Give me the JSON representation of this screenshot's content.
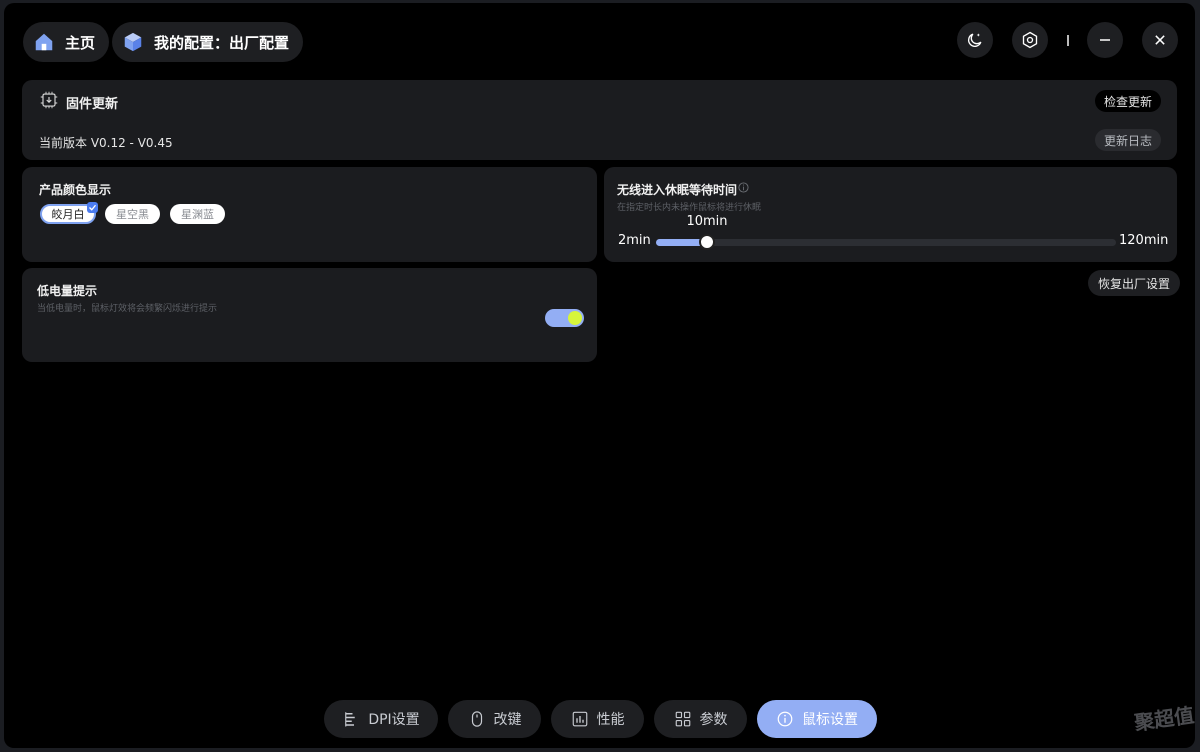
{
  "header": {
    "home_label": "主页",
    "config_label": "我的配置：出厂配置"
  },
  "firmware": {
    "title": "固件更新",
    "version": "当前版本 V0.12 - V0.45",
    "check_update": "检查更新",
    "changelog": "更新日志"
  },
  "color_display": {
    "title": "产品颜色显示",
    "options": [
      "皎月白",
      "星空黑",
      "星渊蓝"
    ],
    "selected": "皎月白"
  },
  "sleep": {
    "title": "无线进入休眠等待时间",
    "subtitle": "在指定时长内未操作鼠标将进行休眠",
    "min_label": "2min",
    "max_label": "120min",
    "value_label": "10min",
    "min": 2,
    "max": 120,
    "value": 10
  },
  "restore_button": "恢复出厂设置",
  "low_battery": {
    "title": "低电量提示",
    "subtitle": "当低电量时，鼠标灯效将会频繁闪烁进行提示",
    "enabled": true
  },
  "bottom_nav": [
    {
      "label": "DPI设置",
      "icon": "dpi-icon",
      "active": false
    },
    {
      "label": "改键",
      "icon": "mouse-icon",
      "active": false
    },
    {
      "label": "性能",
      "icon": "performance-icon",
      "active": false
    },
    {
      "label": "参数",
      "icon": "grid-icon",
      "active": false
    },
    {
      "label": "鼠标设置",
      "icon": "info-icon",
      "active": true
    }
  ],
  "watermark": "聚超值",
  "colors": {
    "accent": "#93aef4",
    "toggle_knob": "#d6f53b",
    "card_bg": "#1b1c1f",
    "window_bg": "#000000"
  }
}
